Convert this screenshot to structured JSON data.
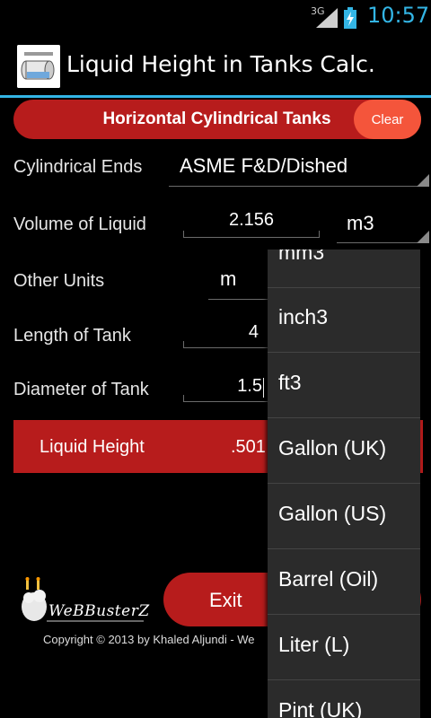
{
  "status_bar": {
    "network": "3G",
    "time": "10:57"
  },
  "action_bar": {
    "title": "Liquid Height in Tanks Calc."
  },
  "header": {
    "title": "Horizontal Cylindrical Tanks",
    "clear_label": "Clear"
  },
  "form": {
    "cylindrical_ends": {
      "label": "Cylindrical Ends",
      "value": "ASME F&D/Dished"
    },
    "volume": {
      "label": "Volume of Liquid",
      "value": "2.156",
      "unit": "m3"
    },
    "other_units": {
      "label": "Other Units",
      "value": "m"
    },
    "length": {
      "label": "Length of Tank",
      "value": "4"
    },
    "diameter": {
      "label": "Diameter of Tank",
      "value": "1.5"
    }
  },
  "result": {
    "label": "Liquid Height",
    "value": ".501"
  },
  "footer": {
    "exit_label": "Exit",
    "logo_text": "WeBBusterZ",
    "copyright": "Copyright © 2013 by Khaled Aljundi - We"
  },
  "dropdown": {
    "items": [
      "mm3",
      "inch3",
      "ft3",
      "Gallon (UK)",
      "Gallon (US)",
      "Barrel (Oil)",
      "Liter (L)",
      "Pint (UK)"
    ]
  },
  "colors": {
    "accent_blue": "#33b5e5",
    "red": "#b71c1c",
    "clear_orange": "#f4553b"
  }
}
